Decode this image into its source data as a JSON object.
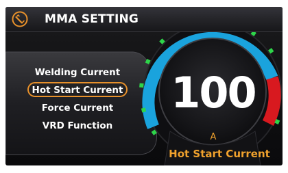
{
  "header": {
    "title": "MMA SETTING",
    "icon": "electrode-holder-icon"
  },
  "menu": {
    "items": [
      {
        "label": "Welding Current",
        "selected": false
      },
      {
        "label": "Hot Start Current",
        "selected": true
      },
      {
        "label": "Force Current",
        "selected": false
      },
      {
        "label": "VRD Function",
        "selected": false
      }
    ]
  },
  "gauge": {
    "value": "100",
    "unit": "A",
    "parameter": "Hot Start Current"
  },
  "colors": {
    "accent_orange": "#e8912b",
    "gauge_blue": "#1aa3dd",
    "gauge_red": "#d8191f",
    "tick_green": "#2ed54a"
  }
}
